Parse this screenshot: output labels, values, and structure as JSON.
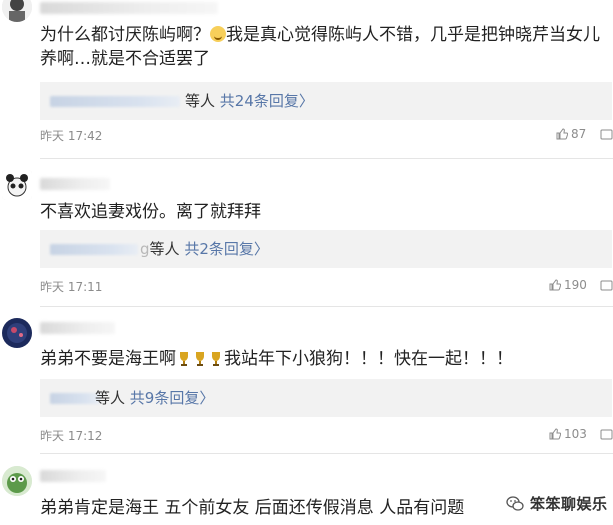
{
  "comments": [
    {
      "text": "为什么都讨厌陈屿啊？",
      "text_after_emoji": "我是真心觉得陈屿人不错，几乎是把钟晓芹当女儿养啊…就是不合适罢了",
      "reply_suffix": "等人 ",
      "reply_link": "共24条回复",
      "reply_chevron": "〉",
      "time": "昨天 17:42",
      "likes": "87"
    },
    {
      "text": "不喜欢追妻戏份。离了就拜拜",
      "reply_prefix_visible": "g",
      "reply_suffix": "等人 ",
      "reply_link": "共2条回复",
      "reply_chevron": "〉",
      "time": "昨天 17:11",
      "likes": "190"
    },
    {
      "text_before_emoji": "弟弟不要是海王啊",
      "text_after_emoji": "我站年下小狼狗！！！快在一起！！！",
      "reply_suffix": "等人 ",
      "reply_link": "共9条回复",
      "reply_chevron": "〉",
      "time": "昨天 17:12",
      "likes": "103"
    },
    {
      "text": "弟弟肯定是海王 五个前女友 后面还传假消息 人品有问题"
    }
  ],
  "watermark": {
    "text": "笨笨聊娱乐"
  },
  "icons": {
    "like": "thumbs-up-icon",
    "comment": "comment-icon",
    "wechat": "wechat-icon"
  },
  "colors": {
    "link": "#5877a8",
    "meta": "#8c8c8c",
    "reply_bg": "#f2f2f2",
    "divider": "#e5e5e5"
  }
}
